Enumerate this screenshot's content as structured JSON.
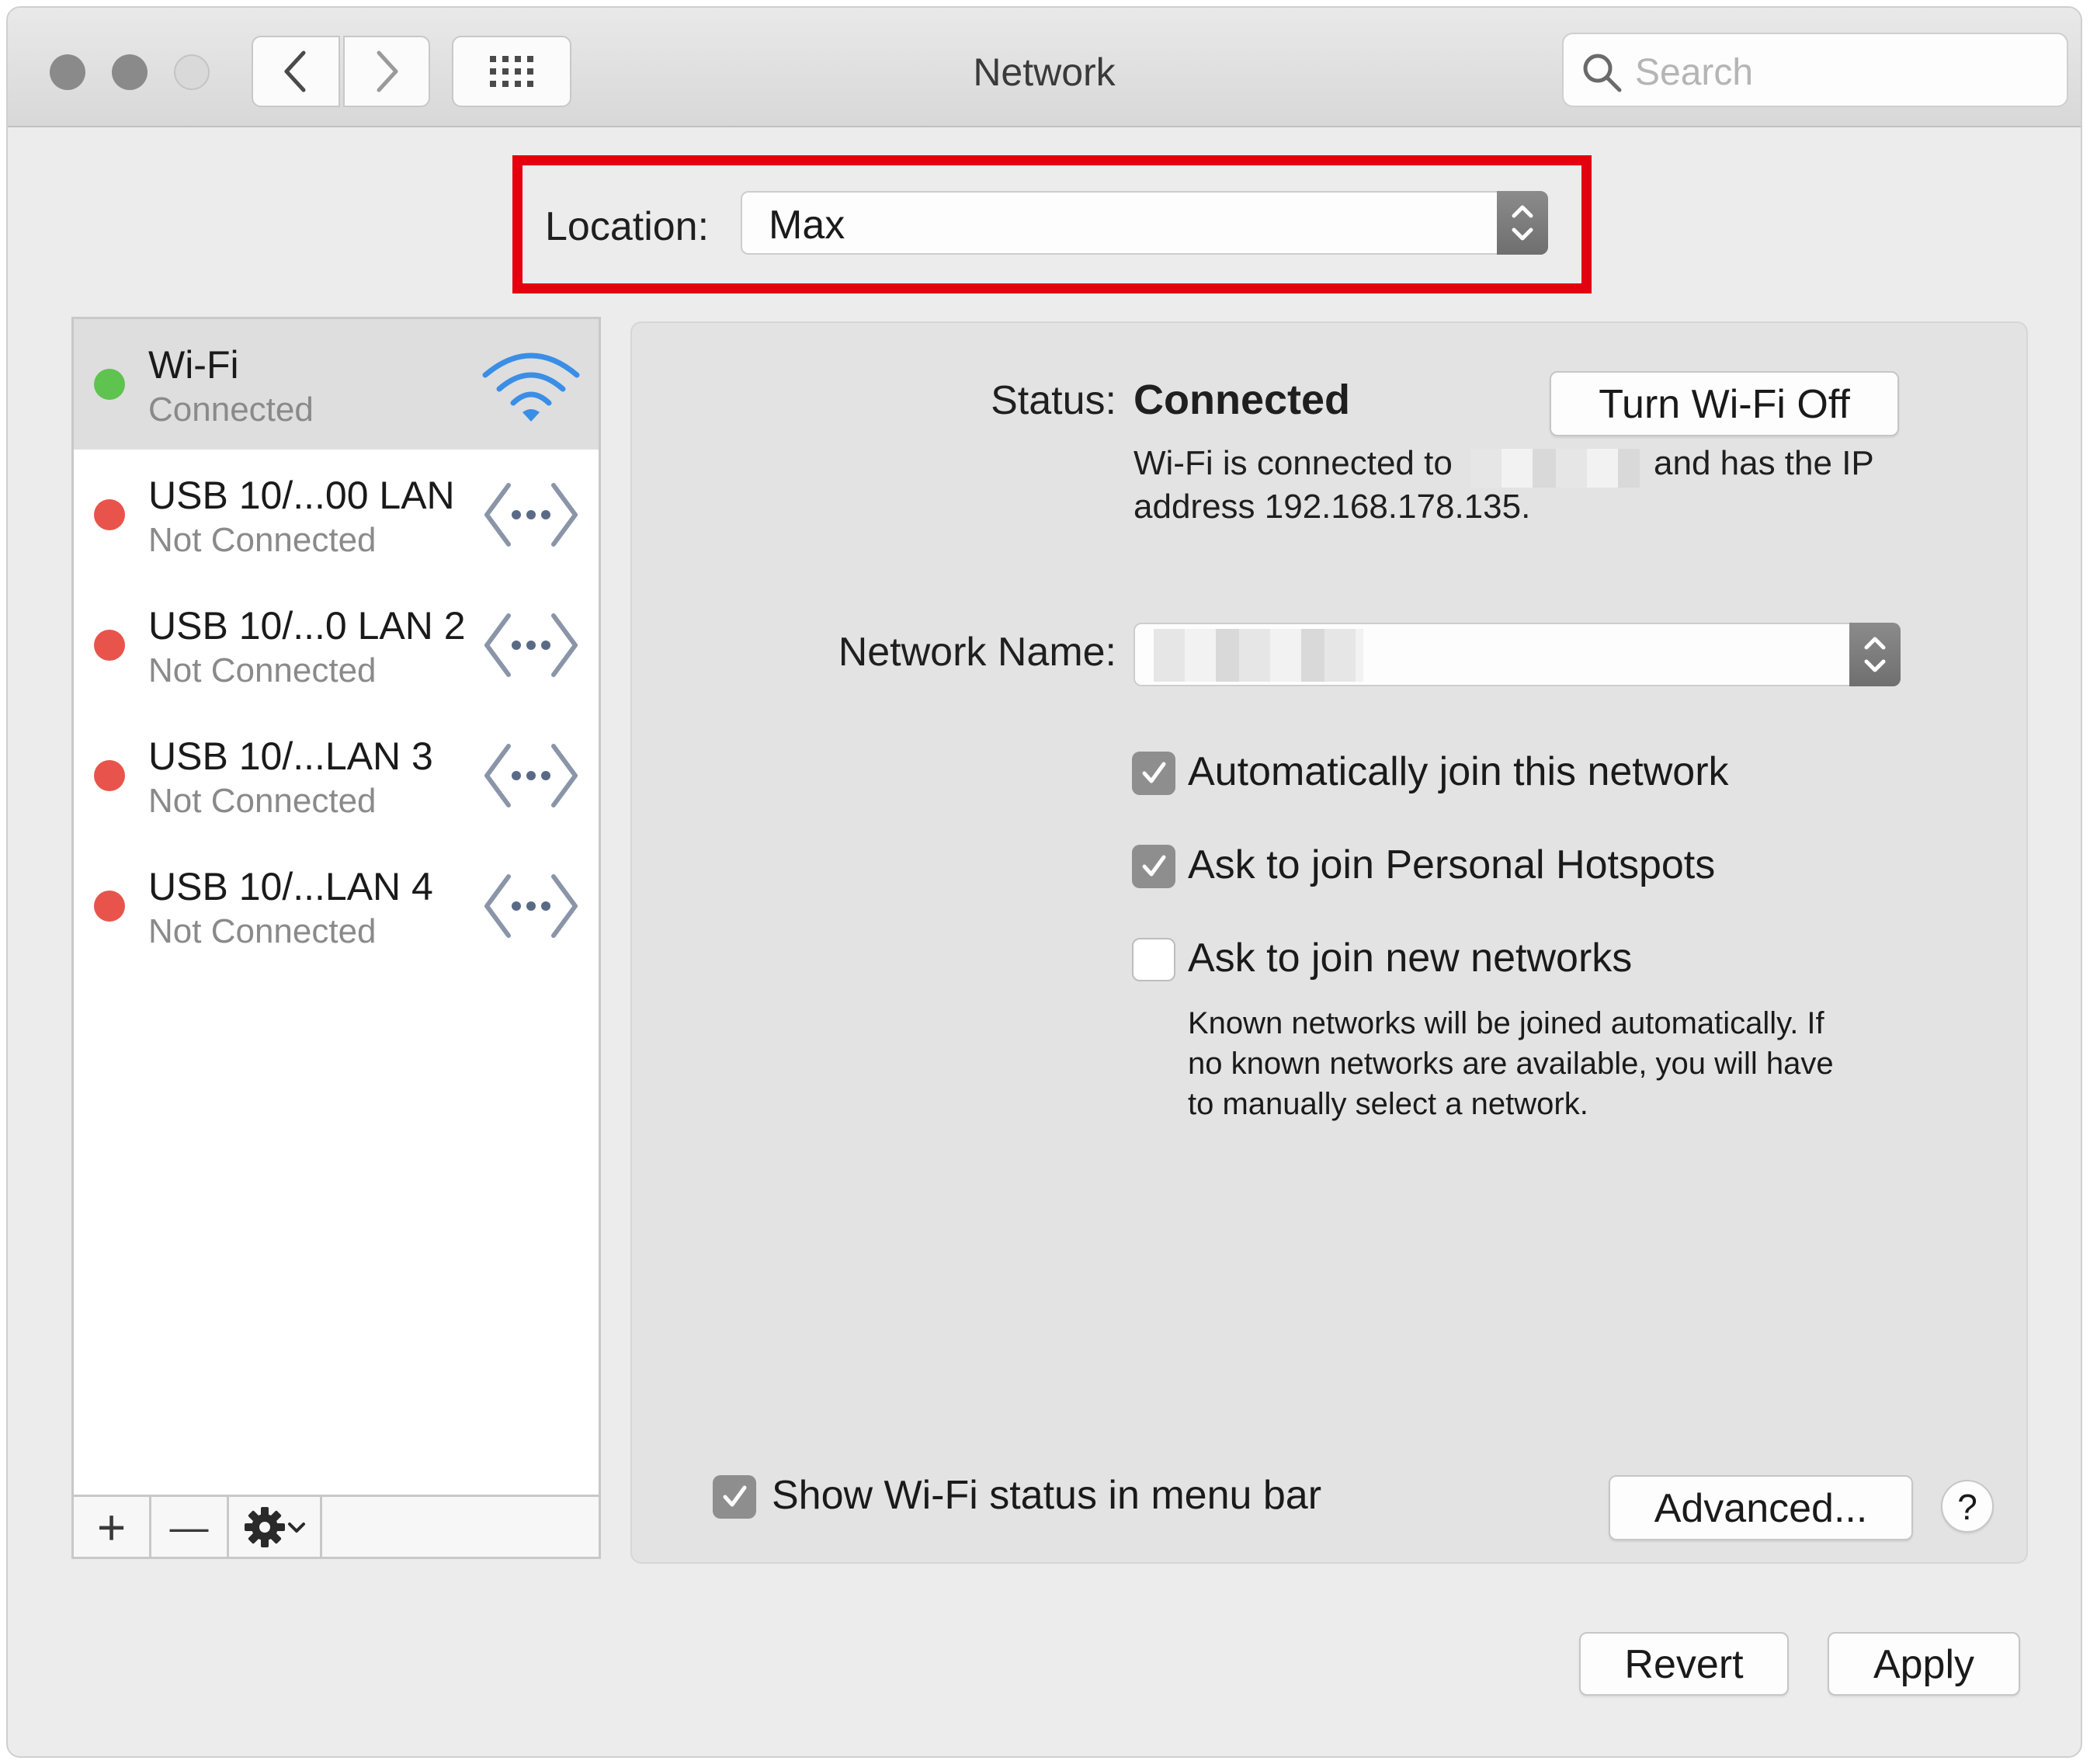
{
  "window": {
    "title": "Network"
  },
  "search": {
    "placeholder": "Search"
  },
  "location": {
    "label": "Location:",
    "value": "Max"
  },
  "services": [
    {
      "name": "Wi-Fi",
      "status": "Connected",
      "state": "connected",
      "icon": "wifi-icon"
    },
    {
      "name": "USB 10/...00 LAN",
      "status": "Not Connected",
      "state": "disconnected",
      "icon": "ethernet-icon"
    },
    {
      "name": "USB 10/...0 LAN 2",
      "status": "Not Connected",
      "state": "disconnected",
      "icon": "ethernet-icon"
    },
    {
      "name": "USB 10/...LAN 3",
      "status": "Not Connected",
      "state": "disconnected",
      "icon": "ethernet-icon"
    },
    {
      "name": "USB 10/...LAN 4",
      "status": "Not Connected",
      "state": "disconnected",
      "icon": "ethernet-icon"
    }
  ],
  "sidebar_actions": {
    "add": "+",
    "remove": "—"
  },
  "detail": {
    "status_label": "Status:",
    "status_value": "Connected",
    "toggle_wifi": "Turn Wi-Fi Off",
    "desc_part1": "Wi-Fi is connected to",
    "desc_part2": "and has the IP",
    "desc_line2": "address 192.168.178.135.",
    "network_name_label": "Network Name:",
    "checkboxes": [
      {
        "label": "Automatically join this network",
        "checked": true
      },
      {
        "label": "Ask to join Personal Hotspots",
        "checked": true
      },
      {
        "label": "Ask to join new networks",
        "checked": false
      }
    ],
    "help_text": [
      "Known networks will be joined automatically. If",
      "no known networks are available, you will have",
      "to manually select a network."
    ],
    "show_status": {
      "label": "Show Wi-Fi status in menu bar",
      "checked": true
    },
    "advanced": "Advanced...",
    "help": "?"
  },
  "footer": {
    "revert": "Revert",
    "apply": "Apply"
  },
  "colors": {
    "connected": "#5ec34f",
    "disconnected": "#e8544b",
    "highlight": "#e3000f",
    "wifi_blue": "#3a8ee6"
  }
}
